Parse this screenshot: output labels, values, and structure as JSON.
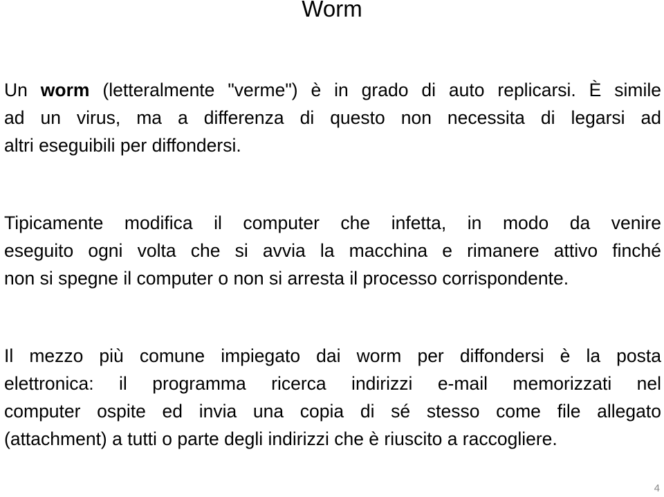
{
  "slide": {
    "title": "Worm",
    "paragraphs": [
      {
        "lines": [
          {
            "pre": "Un ",
            "bold": "worm",
            "post": " (letteralmente \"verme\") è in grado di auto replicarsi. È simile"
          },
          {
            "text": "ad un virus, ma a differenza di questo non necessita di legarsi ad"
          },
          {
            "text": "altri eseguibili per diffondersi."
          }
        ]
      },
      {
        "lines": [
          {
            "text": "Tipicamente modifica il computer che infetta, in modo da venire"
          },
          {
            "text": "eseguito ogni volta che si avvia la macchina e rimanere attivo finché"
          },
          {
            "text": "non si spegne il computer o non si arresta il processo corrispondente."
          }
        ]
      },
      {
        "lines": [
          {
            "text": "Il mezzo più comune impiegato dai worm per diffondersi è la posta"
          },
          {
            "text": "elettronica: il programma ricerca indirizzi e-mail memorizzati nel"
          },
          {
            "text": "computer ospite ed invia una copia di sé stesso come file allegato"
          },
          {
            "text": "(attachment) a tutti o parte degli indirizzi che è riuscito a raccogliere."
          }
        ]
      }
    ],
    "page_number": "4"
  }
}
